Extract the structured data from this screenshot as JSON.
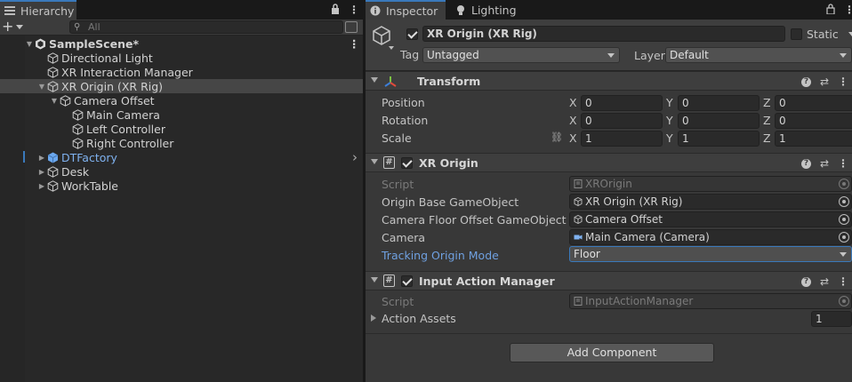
{
  "hierarchy": {
    "tab_label": "Hierarchy",
    "search_placeholder": "All",
    "items": [
      {
        "label": "SampleScene*",
        "depth": 0,
        "expanded": true,
        "kind": "scene"
      },
      {
        "label": "Directional Light",
        "depth": 1,
        "kind": "object"
      },
      {
        "label": "XR Interaction Manager",
        "depth": 1,
        "kind": "object"
      },
      {
        "label": "XR Origin (XR Rig)",
        "depth": 1,
        "expanded": true,
        "kind": "object",
        "selected": true
      },
      {
        "label": "Camera Offset",
        "depth": 2,
        "expanded": true,
        "kind": "object"
      },
      {
        "label": "Main Camera",
        "depth": 3,
        "kind": "object"
      },
      {
        "label": "Left Controller",
        "depth": 3,
        "kind": "object"
      },
      {
        "label": "Right Controller",
        "depth": 3,
        "kind": "object"
      },
      {
        "label": "DTFactory",
        "depth": 1,
        "collapsed": true,
        "kind": "prefab"
      },
      {
        "label": "Desk",
        "depth": 1,
        "collapsed": true,
        "kind": "object"
      },
      {
        "label": "WorkTable",
        "depth": 1,
        "collapsed": true,
        "kind": "object"
      }
    ]
  },
  "inspector": {
    "tabs": [
      {
        "label": "Inspector",
        "active": true
      },
      {
        "label": "Lighting",
        "active": false
      }
    ],
    "object": {
      "name": "XR Origin (XR Rig)",
      "active": true,
      "static_label": "Static",
      "tag_label": "Tag",
      "tag_value": "Untagged",
      "layer_label": "Layer",
      "layer_value": "Default"
    },
    "transform": {
      "title": "Transform",
      "rows": [
        {
          "label": "Position",
          "x": "0",
          "y": "0",
          "z": "0"
        },
        {
          "label": "Rotation",
          "x": "0",
          "y": "0",
          "z": "0"
        },
        {
          "label": "Scale",
          "x": "1",
          "y": "1",
          "z": "1"
        }
      ],
      "axis_x": "X",
      "axis_y": "Y",
      "axis_z": "Z"
    },
    "xr_origin": {
      "title": "XR Origin",
      "enabled": true,
      "script_label": "Script",
      "script_value": "XROrigin",
      "origin_base_label": "Origin Base GameObject",
      "origin_base_value": "XR Origin (XR Rig)",
      "camera_floor_label": "Camera Floor Offset GameObject",
      "camera_floor_value": "Camera Offset",
      "camera_label": "Camera",
      "camera_value": "Main Camera (Camera)",
      "tracking_label": "Tracking Origin Mode",
      "tracking_value": "Floor"
    },
    "input_action_manager": {
      "title": "Input Action Manager",
      "enabled": true,
      "script_label": "Script",
      "script_value": "InputActionManager",
      "action_assets_label": "Action Assets",
      "action_assets_count": "1"
    },
    "add_component_label": "Add Component"
  },
  "colors": {
    "accent_blue": "#3a79bb",
    "prefab_blue": "#7fb2f0",
    "tracking_label_blue": "#6fa0e0"
  }
}
